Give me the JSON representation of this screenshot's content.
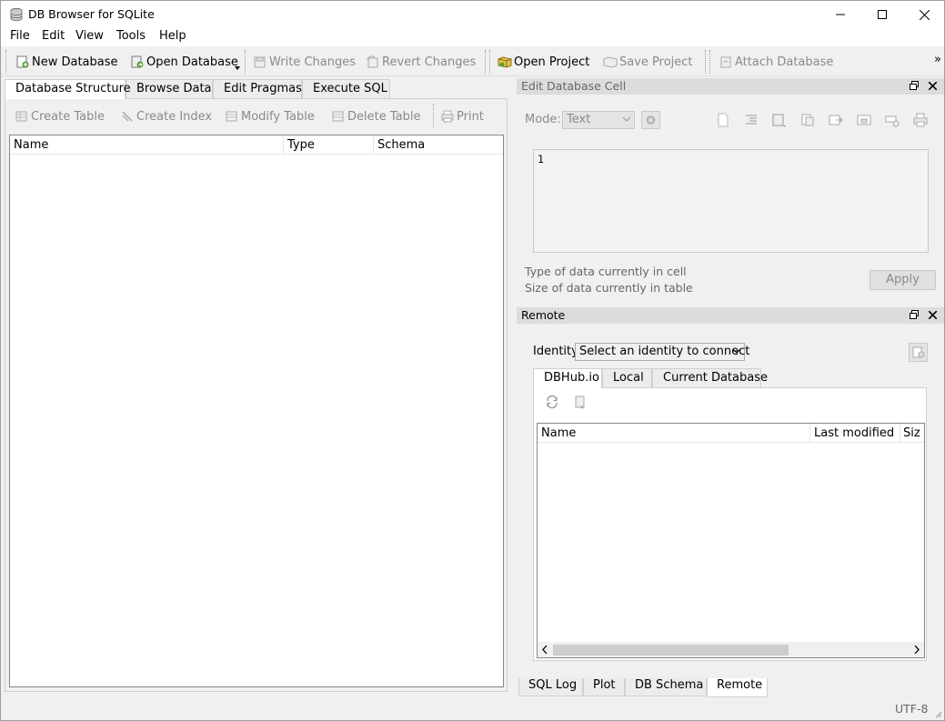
{
  "window": {
    "title": "DB Browser for SQLite"
  },
  "menubar": {
    "items": [
      "File",
      "Edit",
      "View",
      "Tools",
      "Help"
    ]
  },
  "toolbar": {
    "new_database": "New Database",
    "open_database": "Open Database",
    "write_changes": "Write Changes",
    "revert_changes": "Revert Changes",
    "open_project": "Open Project",
    "save_project": "Save Project",
    "attach_database": "Attach Database",
    "overflow": "»"
  },
  "main_tabs": [
    "Database Structure",
    "Browse Data",
    "Edit Pragmas",
    "Execute SQL"
  ],
  "structure_toolbar": {
    "create_table": "Create Table",
    "create_index": "Create Index",
    "modify_table": "Modify Table",
    "delete_table": "Delete Table",
    "print": "Print"
  },
  "structure_tree": {
    "columns": [
      "Name",
      "Type",
      "Schema"
    ]
  },
  "edit_cell": {
    "title": "Edit Database Cell",
    "mode_label": "Mode:",
    "mode_value": "Text",
    "content": "1",
    "type_info": "Type of data currently in cell",
    "size_info": "Size of data currently in table",
    "apply_label": "Apply"
  },
  "remote": {
    "title": "Remote",
    "identity_label": "Identity",
    "identity_value": "Select an identity to connect",
    "tabs": [
      "DBHub.io",
      "Local",
      "Current Database"
    ],
    "columns": [
      "Name",
      "Last modified",
      "Siz"
    ]
  },
  "bottom_tabs": [
    "SQL Log",
    "Plot",
    "DB Schema",
    "Remote"
  ],
  "status": {
    "encoding": "UTF-8"
  }
}
